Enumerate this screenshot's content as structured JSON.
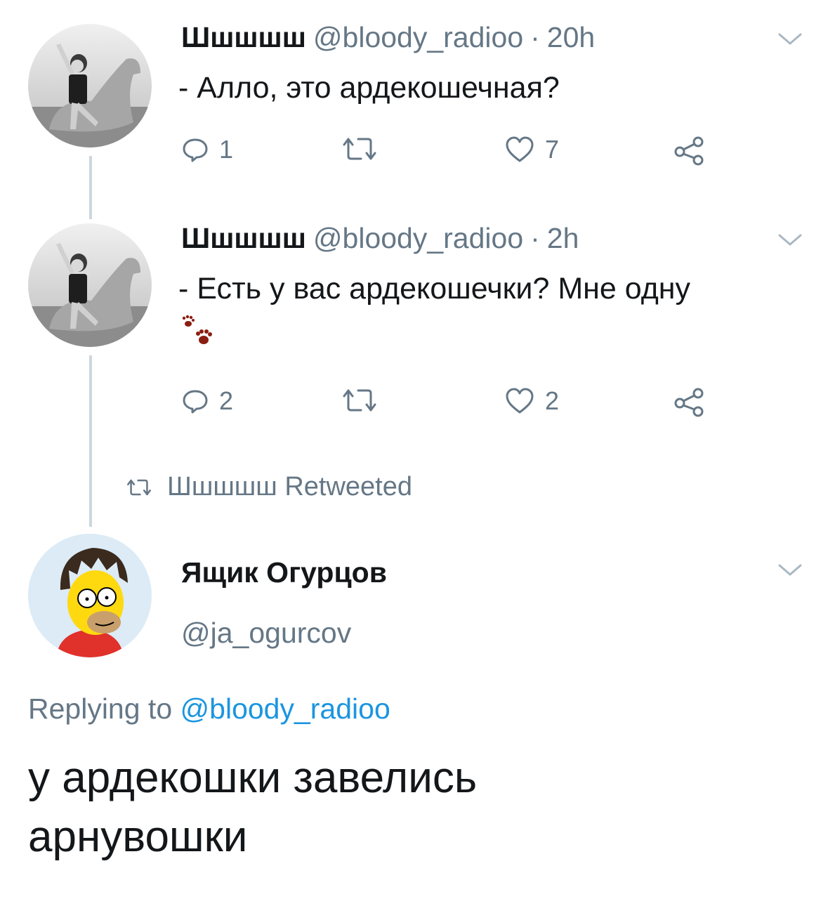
{
  "tweets": [
    {
      "name": "Шшшшш",
      "handle": "@bloody_radioo",
      "sep": "·",
      "time": "20h",
      "text": "- Алло, это ардекошечная?",
      "replies": "1",
      "retweets": "",
      "likes": "7"
    },
    {
      "name": "Шшшшш",
      "handle": "@bloody_radioo",
      "sep": "·",
      "time": "2h",
      "text": "- Есть у вас ардекошечки? Мне одну",
      "emoji": "paw-prints",
      "replies": "2",
      "retweets": "",
      "likes": "2"
    }
  ],
  "retweeted_line": {
    "text": "Шшшшш Retweeted"
  },
  "main_tweet": {
    "name": "Ящик Огурцов",
    "handle": "@ja_ogurcov",
    "replying_prefix": "Replying to",
    "replying_to": "@bloody_radioo",
    "text_line1": "у ардекошки завелись",
    "text_line2": "арнувошки"
  },
  "colors": {
    "text": "#14171a",
    "secondary": "#657786",
    "link": "#1b95e0",
    "thread_line": "#ccd6dd",
    "paw": "#8b1e12"
  },
  "icons": [
    "reply-icon",
    "retweet-icon",
    "like-icon",
    "share-icon",
    "caret-down-icon",
    "paw-prints-icon"
  ]
}
